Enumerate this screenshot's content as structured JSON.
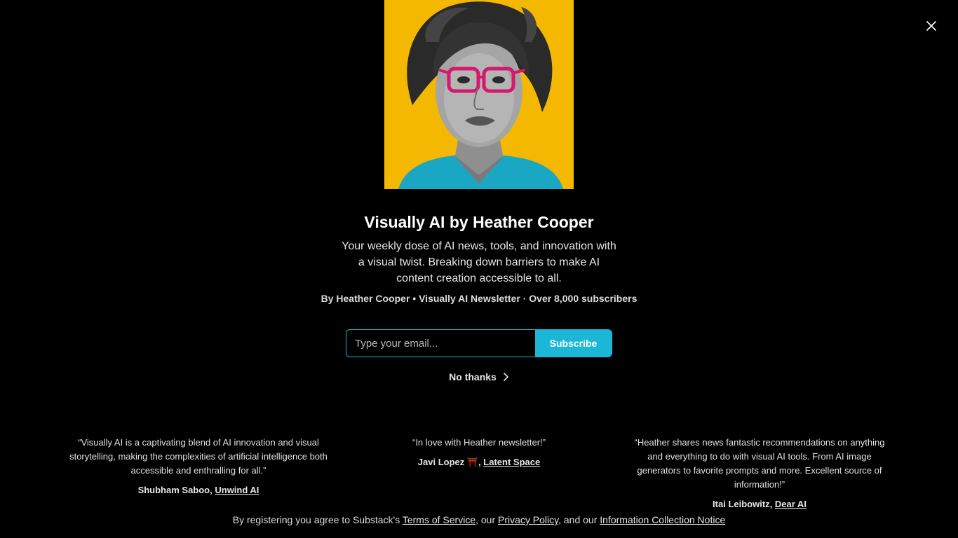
{
  "newsletter": {
    "title": "Visually AI by Heather Cooper",
    "description": "Your weekly dose of AI news, tools, and innovation with a visual twist. Breaking down barriers to make AI content creation accessible to all.",
    "byline": "By Heather Cooper • Visually AI Newsletter · Over 8,000 subscribers"
  },
  "form": {
    "email_placeholder": "Type your email...",
    "subscribe_label": "Subscribe"
  },
  "no_thanks_label": "No thanks",
  "testimonials": [
    {
      "quote": "“Visually AI is a captivating blend of AI innovation and visual storytelling, making the complexities of artificial intelligence both accessible and enthralling for all.”",
      "author": "Shubham Saboo, ",
      "link": "Unwind AI"
    },
    {
      "quote": "“In love with Heather newsletter!”",
      "author": "Javi Lopez ⛩️, ",
      "link": "Latent Space"
    },
    {
      "quote": "“Heather shares news fantastic recommendations on anything and everything to do with visual AI tools. From AI image generators to favorite prompts and more. Excellent source of information!”",
      "author": "Itai Leibowitz, ",
      "link": "Dear AI"
    }
  ],
  "footer": {
    "prefix": "By registering you agree to Substack's ",
    "terms": "Terms of Service",
    "sep1": ", our ",
    "privacy": "Privacy Policy",
    "sep2": ", and our ",
    "notice": "Information Collection Notice"
  },
  "colors": {
    "background": "#000000",
    "accent": "#1ab8d6",
    "portrait_bg": "#f5b800"
  },
  "icons": {
    "close": "close-icon",
    "chevron": "chevron-right-icon"
  }
}
